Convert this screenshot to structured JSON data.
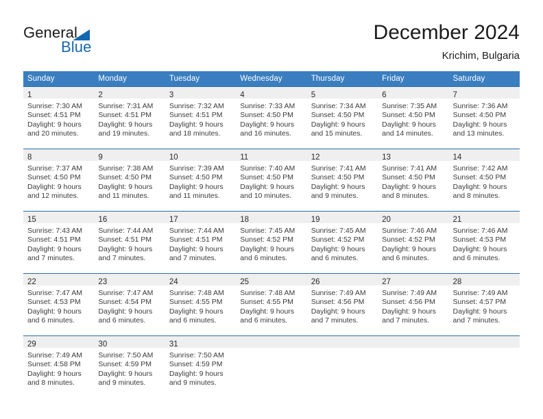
{
  "brand": {
    "name_part1": "General",
    "name_part2": "Blue",
    "logo_icon": "triangle-flag-icon"
  },
  "header": {
    "title": "December 2024",
    "subtitle": "Krichim, Bulgaria"
  },
  "colors": {
    "header_blue": "#3a7ec0",
    "row_border_blue": "#2a6ca8",
    "daynum_strip_gray": "#efefef",
    "brand_blue": "#1367b0",
    "text_dark": "#1c1c1c",
    "text_body": "#3a3a3a"
  },
  "calendar": {
    "weekday_headers": [
      "Sunday",
      "Monday",
      "Tuesday",
      "Wednesday",
      "Thursday",
      "Friday",
      "Saturday"
    ],
    "weeks": [
      [
        {
          "day": "1",
          "sunrise": "Sunrise: 7:30 AM",
          "sunset": "Sunset: 4:51 PM",
          "daylight_1": "Daylight: 9 hours",
          "daylight_2": "and 20 minutes."
        },
        {
          "day": "2",
          "sunrise": "Sunrise: 7:31 AM",
          "sunset": "Sunset: 4:51 PM",
          "daylight_1": "Daylight: 9 hours",
          "daylight_2": "and 19 minutes."
        },
        {
          "day": "3",
          "sunrise": "Sunrise: 7:32 AM",
          "sunset": "Sunset: 4:51 PM",
          "daylight_1": "Daylight: 9 hours",
          "daylight_2": "and 18 minutes."
        },
        {
          "day": "4",
          "sunrise": "Sunrise: 7:33 AM",
          "sunset": "Sunset: 4:50 PM",
          "daylight_1": "Daylight: 9 hours",
          "daylight_2": "and 16 minutes."
        },
        {
          "day": "5",
          "sunrise": "Sunrise: 7:34 AM",
          "sunset": "Sunset: 4:50 PM",
          "daylight_1": "Daylight: 9 hours",
          "daylight_2": "and 15 minutes."
        },
        {
          "day": "6",
          "sunrise": "Sunrise: 7:35 AM",
          "sunset": "Sunset: 4:50 PM",
          "daylight_1": "Daylight: 9 hours",
          "daylight_2": "and 14 minutes."
        },
        {
          "day": "7",
          "sunrise": "Sunrise: 7:36 AM",
          "sunset": "Sunset: 4:50 PM",
          "daylight_1": "Daylight: 9 hours",
          "daylight_2": "and 13 minutes."
        }
      ],
      [
        {
          "day": "8",
          "sunrise": "Sunrise: 7:37 AM",
          "sunset": "Sunset: 4:50 PM",
          "daylight_1": "Daylight: 9 hours",
          "daylight_2": "and 12 minutes."
        },
        {
          "day": "9",
          "sunrise": "Sunrise: 7:38 AM",
          "sunset": "Sunset: 4:50 PM",
          "daylight_1": "Daylight: 9 hours",
          "daylight_2": "and 11 minutes."
        },
        {
          "day": "10",
          "sunrise": "Sunrise: 7:39 AM",
          "sunset": "Sunset: 4:50 PM",
          "daylight_1": "Daylight: 9 hours",
          "daylight_2": "and 11 minutes."
        },
        {
          "day": "11",
          "sunrise": "Sunrise: 7:40 AM",
          "sunset": "Sunset: 4:50 PM",
          "daylight_1": "Daylight: 9 hours",
          "daylight_2": "and 10 minutes."
        },
        {
          "day": "12",
          "sunrise": "Sunrise: 7:41 AM",
          "sunset": "Sunset: 4:50 PM",
          "daylight_1": "Daylight: 9 hours",
          "daylight_2": "and 9 minutes."
        },
        {
          "day": "13",
          "sunrise": "Sunrise: 7:41 AM",
          "sunset": "Sunset: 4:50 PM",
          "daylight_1": "Daylight: 9 hours",
          "daylight_2": "and 8 minutes."
        },
        {
          "day": "14",
          "sunrise": "Sunrise: 7:42 AM",
          "sunset": "Sunset: 4:50 PM",
          "daylight_1": "Daylight: 9 hours",
          "daylight_2": "and 8 minutes."
        }
      ],
      [
        {
          "day": "15",
          "sunrise": "Sunrise: 7:43 AM",
          "sunset": "Sunset: 4:51 PM",
          "daylight_1": "Daylight: 9 hours",
          "daylight_2": "and 7 minutes."
        },
        {
          "day": "16",
          "sunrise": "Sunrise: 7:44 AM",
          "sunset": "Sunset: 4:51 PM",
          "daylight_1": "Daylight: 9 hours",
          "daylight_2": "and 7 minutes."
        },
        {
          "day": "17",
          "sunrise": "Sunrise: 7:44 AM",
          "sunset": "Sunset: 4:51 PM",
          "daylight_1": "Daylight: 9 hours",
          "daylight_2": "and 7 minutes."
        },
        {
          "day": "18",
          "sunrise": "Sunrise: 7:45 AM",
          "sunset": "Sunset: 4:52 PM",
          "daylight_1": "Daylight: 9 hours",
          "daylight_2": "and 6 minutes."
        },
        {
          "day": "19",
          "sunrise": "Sunrise: 7:45 AM",
          "sunset": "Sunset: 4:52 PM",
          "daylight_1": "Daylight: 9 hours",
          "daylight_2": "and 6 minutes."
        },
        {
          "day": "20",
          "sunrise": "Sunrise: 7:46 AM",
          "sunset": "Sunset: 4:52 PM",
          "daylight_1": "Daylight: 9 hours",
          "daylight_2": "and 6 minutes."
        },
        {
          "day": "21",
          "sunrise": "Sunrise: 7:46 AM",
          "sunset": "Sunset: 4:53 PM",
          "daylight_1": "Daylight: 9 hours",
          "daylight_2": "and 6 minutes."
        }
      ],
      [
        {
          "day": "22",
          "sunrise": "Sunrise: 7:47 AM",
          "sunset": "Sunset: 4:53 PM",
          "daylight_1": "Daylight: 9 hours",
          "daylight_2": "and 6 minutes."
        },
        {
          "day": "23",
          "sunrise": "Sunrise: 7:47 AM",
          "sunset": "Sunset: 4:54 PM",
          "daylight_1": "Daylight: 9 hours",
          "daylight_2": "and 6 minutes."
        },
        {
          "day": "24",
          "sunrise": "Sunrise: 7:48 AM",
          "sunset": "Sunset: 4:55 PM",
          "daylight_1": "Daylight: 9 hours",
          "daylight_2": "and 6 minutes."
        },
        {
          "day": "25",
          "sunrise": "Sunrise: 7:48 AM",
          "sunset": "Sunset: 4:55 PM",
          "daylight_1": "Daylight: 9 hours",
          "daylight_2": "and 6 minutes."
        },
        {
          "day": "26",
          "sunrise": "Sunrise: 7:49 AM",
          "sunset": "Sunset: 4:56 PM",
          "daylight_1": "Daylight: 9 hours",
          "daylight_2": "and 7 minutes."
        },
        {
          "day": "27",
          "sunrise": "Sunrise: 7:49 AM",
          "sunset": "Sunset: 4:56 PM",
          "daylight_1": "Daylight: 9 hours",
          "daylight_2": "and 7 minutes."
        },
        {
          "day": "28",
          "sunrise": "Sunrise: 7:49 AM",
          "sunset": "Sunset: 4:57 PM",
          "daylight_1": "Daylight: 9 hours",
          "daylight_2": "and 7 minutes."
        }
      ],
      [
        {
          "day": "29",
          "sunrise": "Sunrise: 7:49 AM",
          "sunset": "Sunset: 4:58 PM",
          "daylight_1": "Daylight: 9 hours",
          "daylight_2": "and 8 minutes."
        },
        {
          "day": "30",
          "sunrise": "Sunrise: 7:50 AM",
          "sunset": "Sunset: 4:59 PM",
          "daylight_1": "Daylight: 9 hours",
          "daylight_2": "and 9 minutes."
        },
        {
          "day": "31",
          "sunrise": "Sunrise: 7:50 AM",
          "sunset": "Sunset: 4:59 PM",
          "daylight_1": "Daylight: 9 hours",
          "daylight_2": "and 9 minutes."
        },
        {
          "day": "",
          "sunrise": "",
          "sunset": "",
          "daylight_1": "",
          "daylight_2": ""
        },
        {
          "day": "",
          "sunrise": "",
          "sunset": "",
          "daylight_1": "",
          "daylight_2": ""
        },
        {
          "day": "",
          "sunrise": "",
          "sunset": "",
          "daylight_1": "",
          "daylight_2": ""
        },
        {
          "day": "",
          "sunrise": "",
          "sunset": "",
          "daylight_1": "",
          "daylight_2": ""
        }
      ]
    ]
  }
}
